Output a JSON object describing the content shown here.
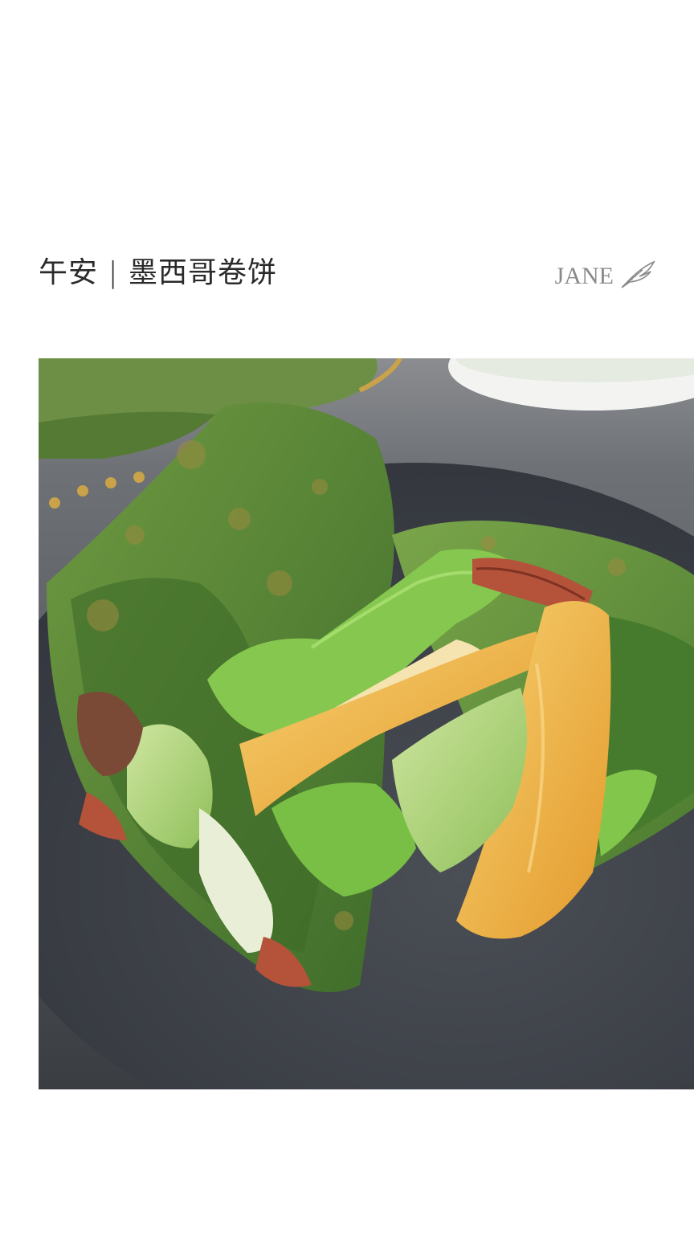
{
  "header": {
    "title": "午安 | 墨西哥卷饼",
    "signature": "JANE",
    "signature_icon": "feather-quill-icon"
  },
  "photo": {
    "subject": "photo",
    "colors": {
      "plate": "#3e4248",
      "tortilla": "#5a8a3a",
      "lettuce": "#7cc24a",
      "egg": "#f0b545",
      "cucumber": "#b8d88a",
      "ham": "#b5523a"
    }
  }
}
